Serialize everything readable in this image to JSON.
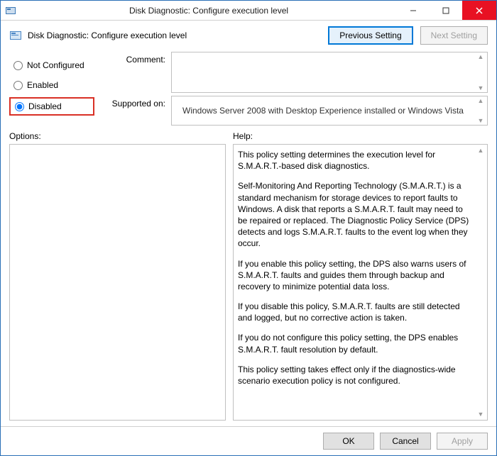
{
  "window": {
    "title": "Disk Diagnostic: Configure execution level"
  },
  "subheader": {
    "title": "Disk Diagnostic: Configure execution level"
  },
  "nav": {
    "previous": "Previous Setting",
    "next": "Next Setting"
  },
  "radios": {
    "not_configured": "Not Configured",
    "enabled": "Enabled",
    "disabled": "Disabled",
    "selected": "disabled"
  },
  "fields": {
    "comment_label": "Comment:",
    "comment_value": "",
    "supported_label": "Supported on:",
    "supported_value": "Windows Server 2008 with Desktop Experience installed or Windows Vista"
  },
  "sections": {
    "options_label": "Options:",
    "help_label": "Help:"
  },
  "help": {
    "p1": "This policy setting determines the execution level for S.M.A.R.T.-based disk diagnostics.",
    "p2": "Self-Monitoring And Reporting Technology (S.M.A.R.T.) is a standard mechanism for storage devices to report faults to Windows. A disk that reports a S.M.A.R.T. fault may need to be repaired or replaced. The Diagnostic Policy Service (DPS) detects and logs S.M.A.R.T. faults to the event log when they occur.",
    "p3": "If you enable this policy setting, the DPS also warns users of S.M.A.R.T. faults and guides them through backup and recovery to minimize potential data loss.",
    "p4": "If you disable this policy, S.M.A.R.T. faults are still detected and logged, but no corrective action is taken.",
    "p5": "If you do not configure this policy setting, the DPS enables S.M.A.R.T. fault resolution by default.",
    "p6": "This policy setting takes effect only if the diagnostics-wide scenario execution policy is not configured."
  },
  "footer": {
    "ok": "OK",
    "cancel": "Cancel",
    "apply": "Apply"
  }
}
